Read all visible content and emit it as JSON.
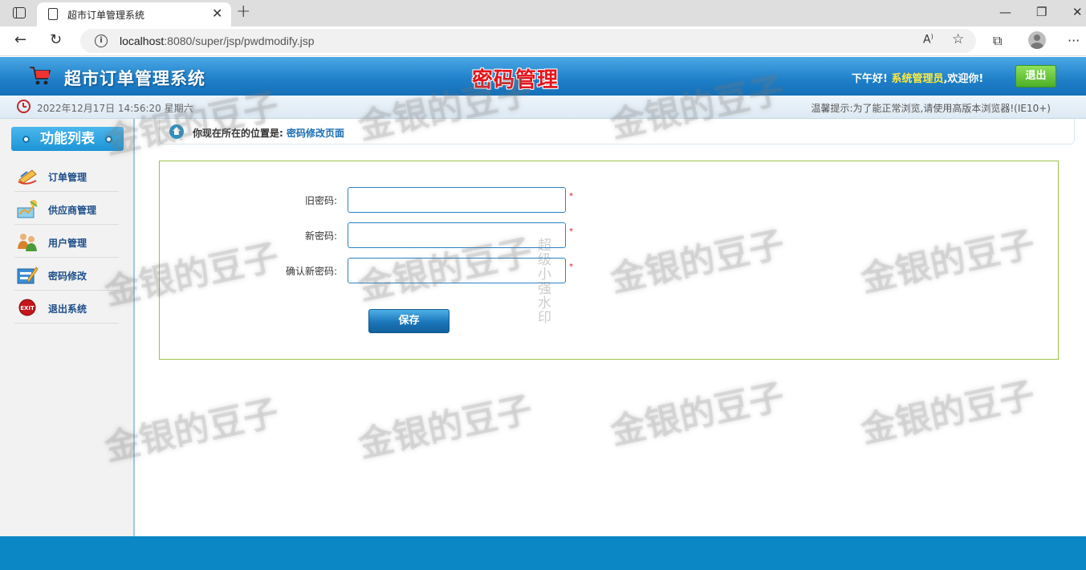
{
  "browser": {
    "tab_title": "超市订单管理系统",
    "url_host": "localhost",
    "url_rest": ":8080/super/jsp/pwdmodify.jsp"
  },
  "header": {
    "system_name": "超市订单管理系统",
    "page_title": "密码管理",
    "greeting": "下午好!",
    "username": "系统管理员",
    "welcome": ",欢迎你!",
    "logout_label": "退出"
  },
  "status": {
    "datetime": "2022年12月17日 14:56:20 星期六",
    "tip": "温馨提示:为了能正常浏览,请使用高版本浏览器!(IE10+)"
  },
  "sidebar": {
    "title": "功能列表",
    "items": [
      {
        "label": "订单管理",
        "icon": "order-icon"
      },
      {
        "label": "供应商管理",
        "icon": "provider-icon"
      },
      {
        "label": "用户管理",
        "icon": "users-icon"
      },
      {
        "label": "密码修改",
        "icon": "password-icon"
      },
      {
        "label": "退出系统",
        "icon": "exit-icon"
      }
    ]
  },
  "breadcrumb": {
    "prefix": "你现在所在的位置是:",
    "current": "密码修改页面"
  },
  "form": {
    "old_password_label": "旧密码:",
    "new_password_label": "新密码:",
    "confirm_password_label": "确认新密码:",
    "required_mark": "*",
    "save_label": "保存"
  },
  "watermark": {
    "text": "金银的豆子",
    "vertical_text": "超级小强水印"
  },
  "colors": {
    "header_blue": "#1e7fc8",
    "page_title_red": "#e6141a",
    "username_yellow": "#ffea3a",
    "logout_green": "#4caf28",
    "footer_blue": "#0a87c4",
    "form_border": "#9fc04a"
  }
}
